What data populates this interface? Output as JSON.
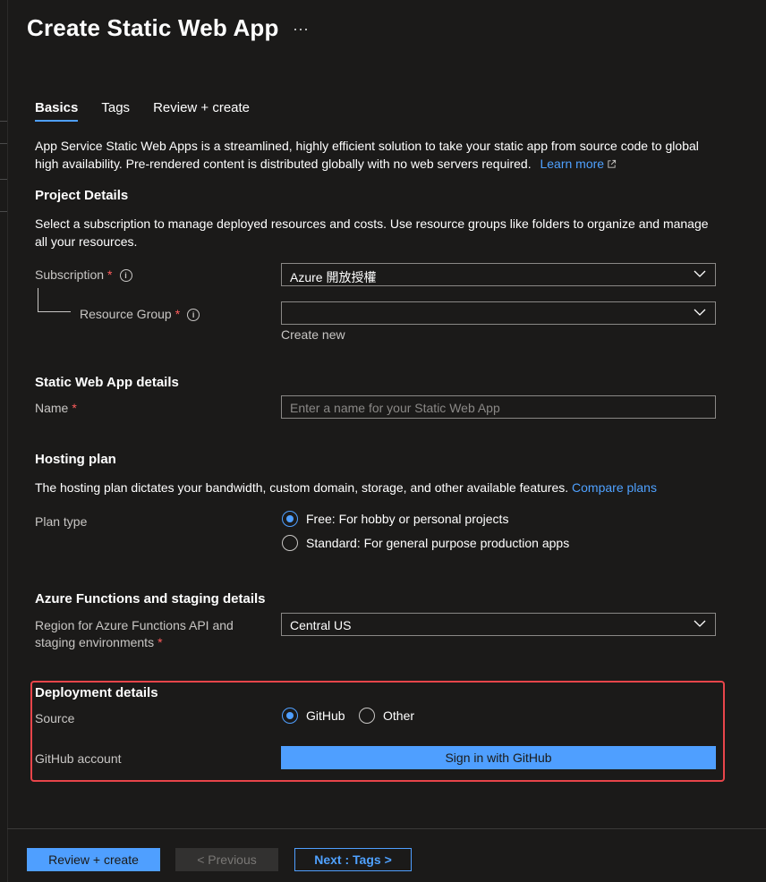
{
  "window": {
    "title": "Create Static Web App",
    "more_label": "···"
  },
  "tabs": [
    {
      "label": "Basics",
      "active": true
    },
    {
      "label": "Tags",
      "active": false
    },
    {
      "label": "Review + create",
      "active": false
    }
  ],
  "intro": {
    "text": "App Service Static Web Apps is a streamlined, highly efficient solution to take your static app from source code to global high availability. Pre-rendered content is distributed globally with no web servers required.",
    "link_text": "Learn more"
  },
  "project_details": {
    "heading": "Project Details",
    "description": "Select a subscription to manage deployed resources and costs. Use resource groups like folders to organize and manage all your resources.",
    "subscription": {
      "label": "Subscription",
      "required": "*",
      "value": "Azure 開放授權"
    },
    "resource_group": {
      "label": "Resource Group",
      "required": "*",
      "value": "",
      "create_new": "Create new"
    }
  },
  "app_details": {
    "heading": "Static Web App details",
    "name": {
      "label": "Name",
      "required": "*",
      "placeholder": "Enter a name for your Static Web App"
    }
  },
  "hosting_plan": {
    "heading": "Hosting plan",
    "description": "The hosting plan dictates your bandwidth, custom domain, storage, and other available features.",
    "link_text": "Compare plans",
    "plan_type_label": "Plan type",
    "options": [
      {
        "label": "Free: For hobby or personal projects",
        "checked": true
      },
      {
        "label": "Standard: For general purpose production apps",
        "checked": false
      }
    ]
  },
  "functions": {
    "heading": "Azure Functions and staging details",
    "region_label_line1": "Region for Azure Functions API and",
    "region_label_line2": "staging environments",
    "required": "*",
    "region_value": "Central US"
  },
  "deployment": {
    "heading": "Deployment details",
    "source_label": "Source",
    "source_options": [
      {
        "label": "GitHub",
        "checked": true
      },
      {
        "label": "Other",
        "checked": false
      }
    ],
    "account_label": "GitHub account",
    "sign_in_label": "Sign in with GitHub"
  },
  "footer": {
    "review_create": "Review + create",
    "previous": "< Previous",
    "next": "Next : Tags >"
  },
  "colors": {
    "background": "#1b1a19",
    "accent": "#4f9fff",
    "link": "#4fa1ff",
    "required": "#ff5c5c",
    "highlight_border": "#e8454a"
  }
}
